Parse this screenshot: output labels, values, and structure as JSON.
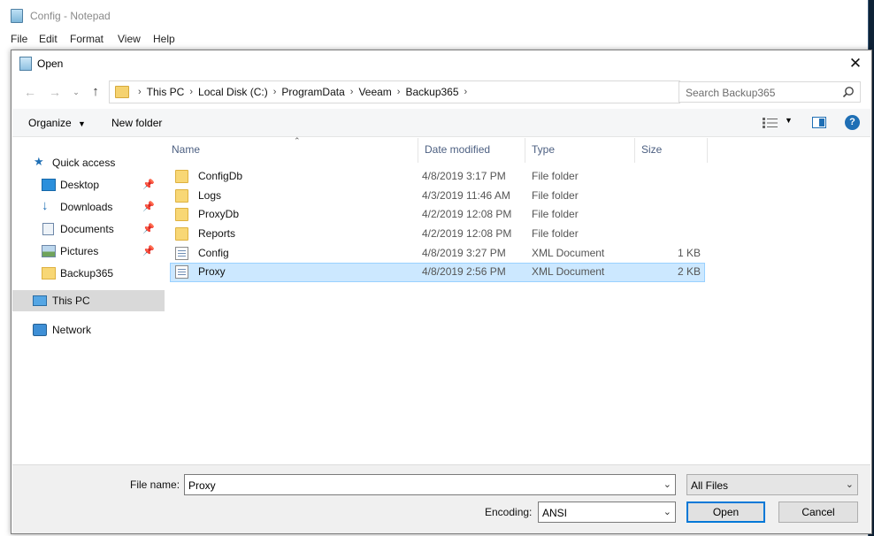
{
  "notepad": {
    "title": "Config - Notepad",
    "menu": [
      "File",
      "Edit",
      "Format",
      "View",
      "Help"
    ]
  },
  "dialog": {
    "title": "Open",
    "close_glyph": "✕",
    "address": {
      "crumbs": [
        "This PC",
        "Local Disk (C:)",
        "ProgramData",
        "Veeam",
        "Backup365"
      ]
    },
    "search_placeholder": "Search Backup365",
    "toolbar": {
      "organize_label": "Organize",
      "new_folder_label": "New folder",
      "help_glyph": "?"
    },
    "nav_pane": {
      "items": [
        {
          "label": "Quick access",
          "icon": "star-icon",
          "pinned": false
        },
        {
          "label": "Desktop",
          "icon": "desktop-icon",
          "pinned": true
        },
        {
          "label": "Downloads",
          "icon": "download-icon",
          "pinned": true
        },
        {
          "label": "Documents",
          "icon": "documents-icon",
          "pinned": true
        },
        {
          "label": "Pictures",
          "icon": "pictures-icon",
          "pinned": true
        },
        {
          "label": "Backup365",
          "icon": "folder-icon",
          "pinned": false
        },
        {
          "label": "This PC",
          "icon": "computer-icon",
          "pinned": false,
          "selected": true
        },
        {
          "label": "Network",
          "icon": "network-icon",
          "pinned": false
        }
      ]
    },
    "columns": [
      "Name",
      "Date modified",
      "Type",
      "Size"
    ],
    "files": [
      {
        "name": "ConfigDb",
        "date": "4/8/2019 3:17 PM",
        "type": "File folder",
        "size": "",
        "kind": "folder"
      },
      {
        "name": "Logs",
        "date": "4/3/2019 11:46 AM",
        "type": "File folder",
        "size": "",
        "kind": "folder"
      },
      {
        "name": "ProxyDb",
        "date": "4/2/2019 12:08 PM",
        "type": "File folder",
        "size": "",
        "kind": "folder"
      },
      {
        "name": "Reports",
        "date": "4/2/2019 12:08 PM",
        "type": "File folder",
        "size": "",
        "kind": "folder"
      },
      {
        "name": "Config",
        "date": "4/8/2019 3:27 PM",
        "type": "XML Document",
        "size": "1 KB",
        "kind": "xml"
      },
      {
        "name": "Proxy",
        "date": "4/8/2019 2:56 PM",
        "type": "XML Document",
        "size": "2 KB",
        "kind": "xml",
        "selected": true
      }
    ],
    "footer": {
      "file_name_label": "File name:",
      "file_name_value": "Proxy",
      "filter_value": "All Files",
      "encoding_label": "Encoding:",
      "encoding_value": "ANSI",
      "open_label": "Open",
      "cancel_label": "Cancel"
    }
  },
  "colors": {
    "selection_bg": "#cce8ff",
    "selection_border": "#99d1ff",
    "accent": "#0078d7",
    "folder": "#f8d775"
  }
}
